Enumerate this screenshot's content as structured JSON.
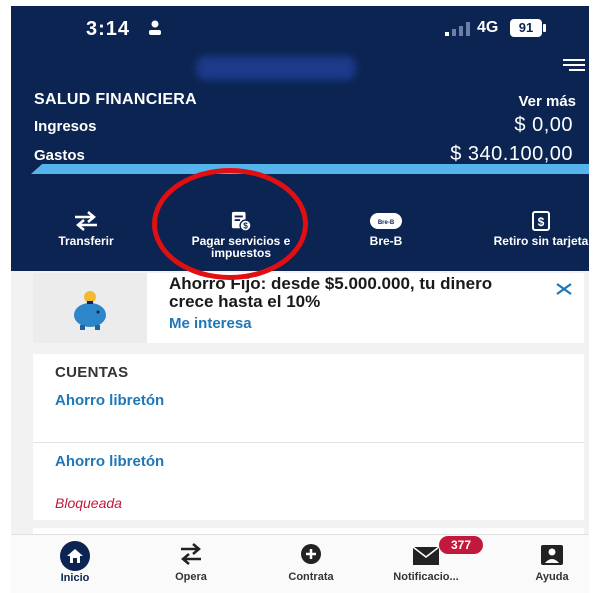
{
  "status_bar": {
    "time": "3:14",
    "network": "4G",
    "battery": "91"
  },
  "header": {
    "section_title": "SALUD FINANCIERA",
    "see_more": "Ver más",
    "ingresos_label": "Ingresos",
    "ingresos_value": "$ 0,00",
    "gastos_label": "Gastos",
    "gastos_value": "$ 340.100,00",
    "gastos_progress": 1.0
  },
  "quick_actions": [
    {
      "label": "Transferir",
      "icon": "transfer-arrows-icon"
    },
    {
      "label": "Pagar servicios e impuestos",
      "icon": "bill-payment-icon"
    },
    {
      "label": "Bre-B",
      "icon": "breb-icon",
      "icon_text": "Bre-B"
    },
    {
      "label": "Retiro sin tarjeta",
      "icon": "cash-withdrawal-icon"
    }
  ],
  "promo": {
    "text": "Ahorro Fijo: desde $5.000.000, tu dinero crece hasta el 10%",
    "link": "Me interesa"
  },
  "accounts": {
    "title": "CUENTAS",
    "items": [
      {
        "name": "Ahorro libretón",
        "status": ""
      },
      {
        "name": "Ahorro libretón",
        "status": "Bloqueada"
      }
    ]
  },
  "bottom_nav": [
    {
      "label": "Inicio",
      "icon": "home-icon",
      "active": true
    },
    {
      "label": "Opera",
      "icon": "transfer-arrows-icon"
    },
    {
      "label": "Contrata",
      "icon": "plus-icon"
    },
    {
      "label": "Notificacio...",
      "icon": "mail-icon",
      "badge": "377"
    },
    {
      "label": "Ayuda",
      "icon": "help-person-icon"
    }
  ],
  "colors": {
    "header_bg": "#0b2451",
    "accent_blue": "#1f77b8",
    "progress": "#55b4ec",
    "alert_red": "#c2183b",
    "highlight_circle": "#e20f12"
  }
}
